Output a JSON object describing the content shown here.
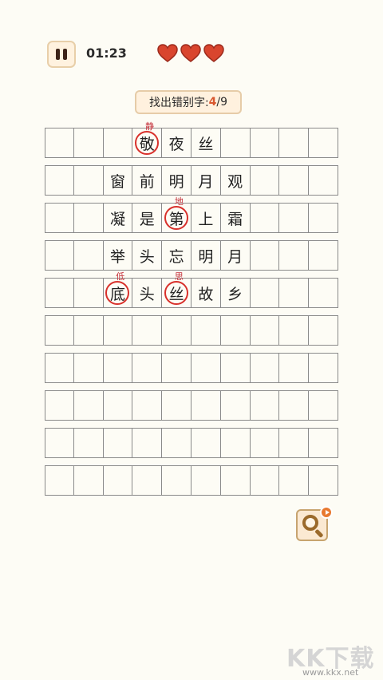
{
  "header": {
    "pause_icon": "pause-icon",
    "timer": "01:23",
    "hearts": [
      "heart-icon",
      "heart-icon",
      "heart-icon"
    ],
    "heart_color": "#d9452e"
  },
  "progress": {
    "label": "找出错别字:",
    "found": "4",
    "total": "/9"
  },
  "grid": {
    "rows": [
      [
        {
          "c": ""
        },
        {
          "c": ""
        },
        {
          "c": ""
        },
        {
          "c": "敬",
          "fix": "静",
          "wrong": true
        },
        {
          "c": "夜"
        },
        {
          "c": "丝"
        },
        {
          "c": ""
        },
        {
          "c": ""
        },
        {
          "c": ""
        },
        {
          "c": ""
        }
      ],
      [
        {
          "c": ""
        },
        {
          "c": ""
        },
        {
          "c": "窗"
        },
        {
          "c": "前"
        },
        {
          "c": "明"
        },
        {
          "c": "月"
        },
        {
          "c": "观"
        },
        {
          "c": ""
        },
        {
          "c": ""
        },
        {
          "c": ""
        }
      ],
      [
        {
          "c": ""
        },
        {
          "c": ""
        },
        {
          "c": "凝"
        },
        {
          "c": "是"
        },
        {
          "c": "第",
          "fix": "地",
          "wrong": true
        },
        {
          "c": "上"
        },
        {
          "c": "霜"
        },
        {
          "c": ""
        },
        {
          "c": ""
        },
        {
          "c": ""
        }
      ],
      [
        {
          "c": ""
        },
        {
          "c": ""
        },
        {
          "c": "举"
        },
        {
          "c": "头"
        },
        {
          "c": "忘"
        },
        {
          "c": "明"
        },
        {
          "c": "月"
        },
        {
          "c": ""
        },
        {
          "c": ""
        },
        {
          "c": ""
        }
      ],
      [
        {
          "c": ""
        },
        {
          "c": ""
        },
        {
          "c": "底",
          "fix": "低",
          "wrong": true
        },
        {
          "c": "头"
        },
        {
          "c": "丝",
          "fix": "思",
          "wrong": true
        },
        {
          "c": "故"
        },
        {
          "c": "乡"
        },
        {
          "c": ""
        },
        {
          "c": ""
        },
        {
          "c": ""
        }
      ],
      [
        {
          "c": ""
        },
        {
          "c": ""
        },
        {
          "c": ""
        },
        {
          "c": ""
        },
        {
          "c": ""
        },
        {
          "c": ""
        },
        {
          "c": ""
        },
        {
          "c": ""
        },
        {
          "c": ""
        },
        {
          "c": ""
        }
      ],
      [
        {
          "c": ""
        },
        {
          "c": ""
        },
        {
          "c": ""
        },
        {
          "c": ""
        },
        {
          "c": ""
        },
        {
          "c": ""
        },
        {
          "c": ""
        },
        {
          "c": ""
        },
        {
          "c": ""
        },
        {
          "c": ""
        }
      ],
      [
        {
          "c": ""
        },
        {
          "c": ""
        },
        {
          "c": ""
        },
        {
          "c": ""
        },
        {
          "c": ""
        },
        {
          "c": ""
        },
        {
          "c": ""
        },
        {
          "c": ""
        },
        {
          "c": ""
        },
        {
          "c": ""
        }
      ],
      [
        {
          "c": ""
        },
        {
          "c": ""
        },
        {
          "c": ""
        },
        {
          "c": ""
        },
        {
          "c": ""
        },
        {
          "c": ""
        },
        {
          "c": ""
        },
        {
          "c": ""
        },
        {
          "c": ""
        },
        {
          "c": ""
        }
      ],
      [
        {
          "c": ""
        },
        {
          "c": ""
        },
        {
          "c": ""
        },
        {
          "c": ""
        },
        {
          "c": ""
        },
        {
          "c": ""
        },
        {
          "c": ""
        },
        {
          "c": ""
        },
        {
          "c": ""
        },
        {
          "c": ""
        }
      ]
    ]
  },
  "hint_button": {
    "icon": "magnifier-icon",
    "badge_icon": "play-video-icon"
  },
  "watermark": {
    "big": "KK下载",
    "small": "www.kkx.net"
  }
}
